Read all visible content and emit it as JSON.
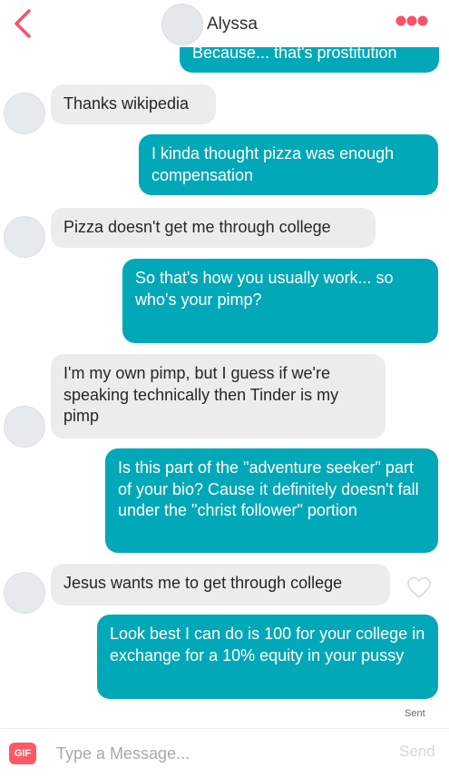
{
  "header": {
    "contact_name": "Alyssa",
    "accent_color": "#fd5068",
    "back_icon": "chevron-left-icon",
    "menu_icon": "more-dots-icon"
  },
  "messages": [
    {
      "sender": "me",
      "text": "Because... that's prostitution"
    },
    {
      "sender": "Alyssa",
      "text": "Thanks wikipedia"
    },
    {
      "sender": "me",
      "text": "I kinda thought pizza was enough compensation"
    },
    {
      "sender": "Alyssa",
      "text": "Pizza doesn't get me through college"
    },
    {
      "sender": "me",
      "text": "So that's how you usually work... so who's your pimp?"
    },
    {
      "sender": "Alyssa",
      "text": "I'm my own pimp, but I guess if we're speaking technically then Tinder is my pimp"
    },
    {
      "sender": "me",
      "text": "Is this part of the \"adventure seeker\" part of your bio? Cause it definitely doesn't fall under the \"christ follower\" portion"
    },
    {
      "sender": "Alyssa",
      "text": "Jesus wants me to get through college"
    },
    {
      "sender": "me",
      "text": "Look best I can do is 100 for your college in exchange for a 10% equity in your pussy"
    }
  ],
  "status": {
    "sent_label": "Sent"
  },
  "composer": {
    "gif_label": "GIF",
    "placeholder": "Type a Message...",
    "send_label": "Send"
  },
  "colors": {
    "outgoing_bubble": "#00a8b8",
    "incoming_bubble": "#ececec",
    "gif_button": "#ff5864"
  }
}
